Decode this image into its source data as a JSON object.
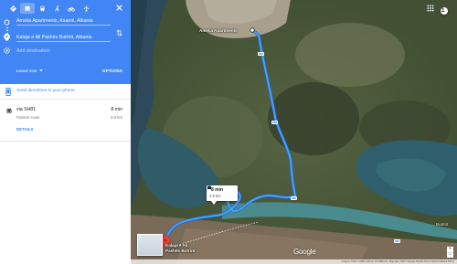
{
  "travel_modes": [
    "best-mode-icon",
    "car-icon",
    "transit-icon",
    "walk-icon",
    "bicycle-icon",
    "flight-icon"
  ],
  "origin": {
    "value": "Amelia Apartments, Ksamil, Albania"
  },
  "destination": {
    "value": "Kalaja e Ali Pashës Butrint, Albania"
  },
  "add_destination": {
    "placeholder": "Add destination"
  },
  "leave_now": "Leave now",
  "options": "OPTIONS",
  "send_directions": "Send directions to your phone",
  "route": {
    "via": "via SH81",
    "time": "8 min",
    "note": "Fastest route",
    "distance": "3.9 km",
    "details": "DETAILS"
  },
  "map": {
    "origin_label": "Amelia Apartments",
    "town_label": "Butrint",
    "destination_label_line1": "Kalaja e Ali",
    "destination_label_line2": "Pashës Butrint",
    "callout_time": "8 min",
    "callout_distance": "3.9 km",
    "road_shield": "SH81",
    "logo": "Google",
    "footer": "Imagery ©2017 CNES / Airbus, TerraMetrics, Map data ©2017 Google   Albania   Terms   Send feedback   200 m"
  },
  "colors": {
    "accent": "#4285f4",
    "route": "#4a9df8",
    "pin": "#ea4335"
  }
}
